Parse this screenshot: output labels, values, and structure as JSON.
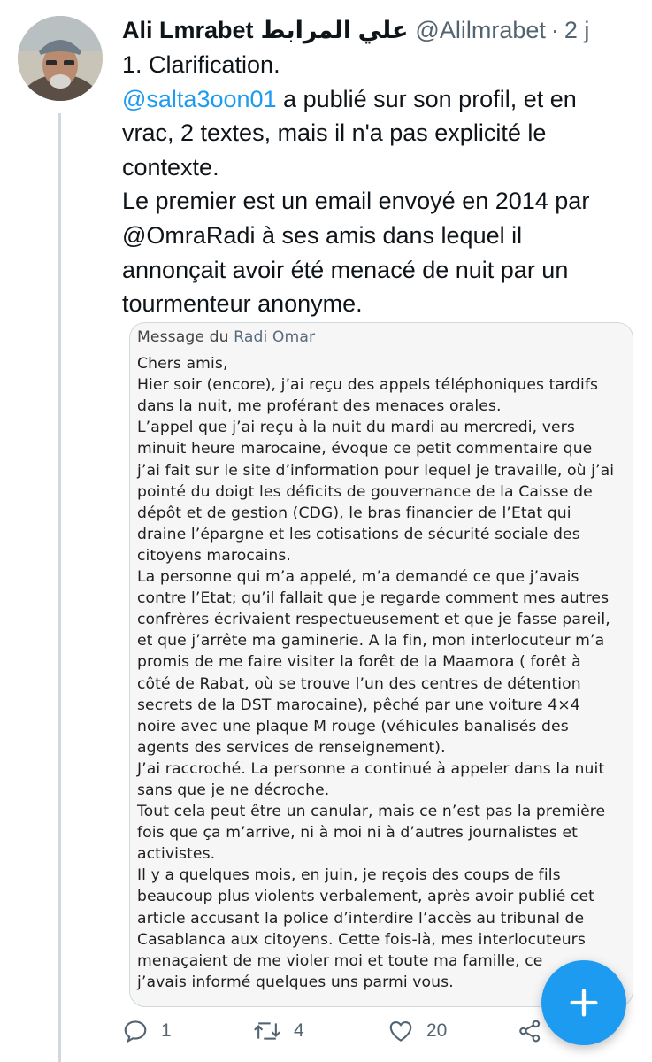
{
  "tweet": {
    "author_name": "Ali Lmrabet",
    "author_name_ar": "علي المرابط",
    "handle": "@Alilmrabet",
    "separator": "·",
    "time": "2 j",
    "lines": [
      {
        "text": "1. Clarification."
      },
      {
        "mention": "@salta3oon01",
        "text": " a publié sur son profil, et en"
      },
      {
        "text": "vrac, 2 textes, mais il n'a pas explicité le"
      },
      {
        "text": "contexte."
      },
      {
        "text": "Le premier est un email envoyé en 2014 par"
      },
      {
        "text": "@OmraRadi à ses amis dans lequel il"
      },
      {
        "text": "annonçait avoir été menacé de nuit par un"
      },
      {
        "text": "tourmenteur anonyme."
      }
    ]
  },
  "media": {
    "header_prefix": "Message du ",
    "header_from": "Radi Omar",
    "lines": [
      "Chers amis,",
      "Hier soir (encore), j’ai reçu des appels téléphoniques tardifs",
      "dans la nuit, me proférant des menaces orales.",
      "L’appel que j’ai reçu à la nuit du mardi au mercredi, vers",
      "minuit heure marocaine, évoque ce petit commentaire que",
      "j’ai fait sur le site d’information pour lequel je travaille, où j’ai",
      "pointé du doigt les déficits de gouvernance de la Caisse de",
      "dépôt et de gestion (CDG), le bras financier de l’Etat qui",
      "draine l’épargne et les cotisations de sécurité sociale des",
      "citoyens marocains.",
      "La personne qui m’a appelé, m’a demandé ce que j’avais",
      "contre l’Etat; qu’il fallait que je regarde comment mes autres",
      "confrères écrivaient respectueusement et que je fasse pareil,",
      "et que j’arrête ma gaminerie. A la fin, mon interlocuteur m’a",
      "promis de me faire visiter la forêt de la Maamora ( forêt à",
      "côté de Rabat, où se trouve l’un des centres de détention",
      "secrets de la DST marocaine), pêché par une voiture 4×4",
      "noire avec une plaque M rouge (véhicules banalisés des",
      "agents des services de renseignement).",
      "J’ai raccroché. La personne a continué à appeler dans la nuit",
      "sans que je ne décroche.",
      "Tout cela peut être un canular, mais ce n’est pas la première",
      "fois que ça m’arrive, ni à moi ni à d’autres journalistes et",
      "activistes.",
      "Il y a quelques mois, en juin, je reçois des coups de fils",
      "beaucoup plus violents verbalement, après avoir publié cet",
      "article accusant la police d’interdire l’accès au tribunal de",
      "Casablanca aux citoyens. Cette fois-là, mes interlocuteurs",
      "menaçaient de me violer moi et toute ma famille, ce",
      "j’avais informé quelques uns parmi vous."
    ]
  },
  "actions": {
    "reply_count": "1",
    "retweet_count": "4",
    "like_count": "20",
    "icons": [
      "reply-icon",
      "retweet-icon",
      "like-icon",
      "share-icon"
    ]
  },
  "fab": {
    "icon": "plus-icon"
  },
  "colors": {
    "accent": "#1d9bf0",
    "muted": "#536471",
    "text": "#0f1419"
  }
}
